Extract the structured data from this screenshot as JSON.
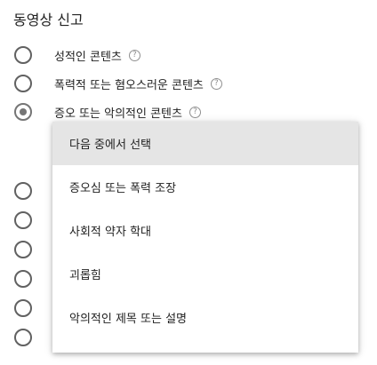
{
  "title": "동영상 신고",
  "options": [
    {
      "label": "성적인 콘텐츠",
      "help": "?"
    },
    {
      "label": "폭력적 또는 혐오스러운 콘텐츠",
      "help": "?"
    },
    {
      "label": "증오 또는 악의적인 콘텐츠",
      "help": "?"
    }
  ],
  "dropdown": {
    "items": [
      {
        "label": "다음 중에서 선택"
      },
      {
        "label": "증오심 또는 폭력 조장"
      },
      {
        "label": "사회적 약자 학대"
      },
      {
        "label": "괴롭힘"
      },
      {
        "label": "악의적인 제목 또는 설명"
      }
    ]
  },
  "colors": {
    "radio_border": "#616161",
    "selected_highlight": "#e5e5e5",
    "text": "#212121",
    "help_icon": "#909090"
  }
}
